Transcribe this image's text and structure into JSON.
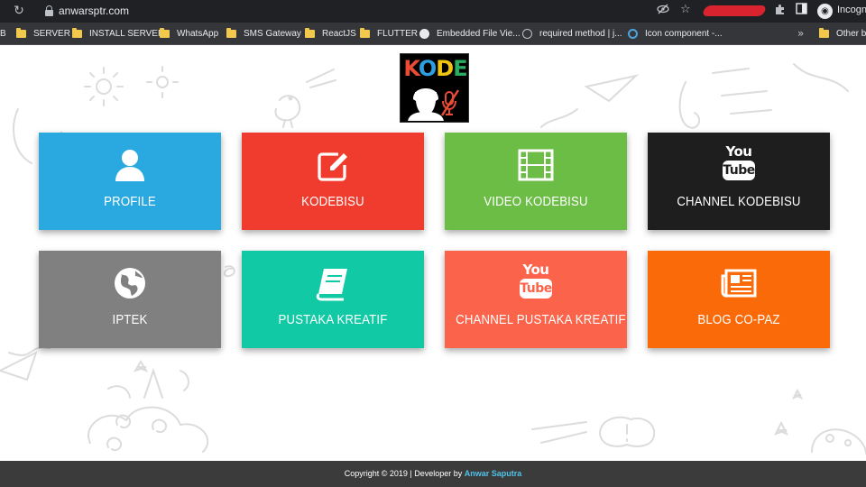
{
  "browser": {
    "url": "anwarsptr.com",
    "profile_label": "Incognito",
    "bookmarks": [
      {
        "label": "B",
        "kind": "none"
      },
      {
        "label": "SERVER",
        "kind": "folder"
      },
      {
        "label": "INSTALL SERVER",
        "kind": "folder"
      },
      {
        "label": "WhatsApp",
        "kind": "folder"
      },
      {
        "label": "SMS Gateway",
        "kind": "folder"
      },
      {
        "label": "ReactJS",
        "kind": "folder"
      },
      {
        "label": "FLUTTER",
        "kind": "folder"
      },
      {
        "label": "Embedded File Vie...",
        "kind": "github"
      },
      {
        "label": "required method | j...",
        "kind": "globe"
      },
      {
        "label": "Icon component -...",
        "kind": "spinner"
      }
    ],
    "other_bookmarks_label": "Other bookmarks",
    "more_label": "»"
  },
  "logo": {
    "word": [
      "K",
      "O",
      "D",
      "E"
    ]
  },
  "tiles": [
    {
      "label": "PROFILE",
      "icon": "user-icon",
      "color": "#2aa9e0"
    },
    {
      "label": "KODEBISU",
      "icon": "edit-icon",
      "color": "#f03c2e"
    },
    {
      "label": "VIDEO KODEBISU",
      "icon": "film-icon",
      "color": "#6cbd45"
    },
    {
      "label": "CHANNEL KODEBISU",
      "icon": "youtube-icon",
      "color": "#1e1e1e"
    },
    {
      "label": "IPTEK",
      "icon": "globe-icon",
      "color": "#808080"
    },
    {
      "label": "PUSTAKA KREATIF",
      "icon": "book-icon",
      "color": "#12c9a5"
    },
    {
      "label": "CHANNEL PUSTAKA KREATIF",
      "icon": "youtube-icon",
      "color": "#fb634a"
    },
    {
      "label": "BLOG CO-PAZ",
      "icon": "newspaper-icon",
      "color": "#fb6a09"
    }
  ],
  "youtube": {
    "you": "You",
    "tube": "Tube"
  },
  "footer": {
    "text": "Copyright © 2019 | Developer by",
    "author": "Anwar Saputra"
  }
}
